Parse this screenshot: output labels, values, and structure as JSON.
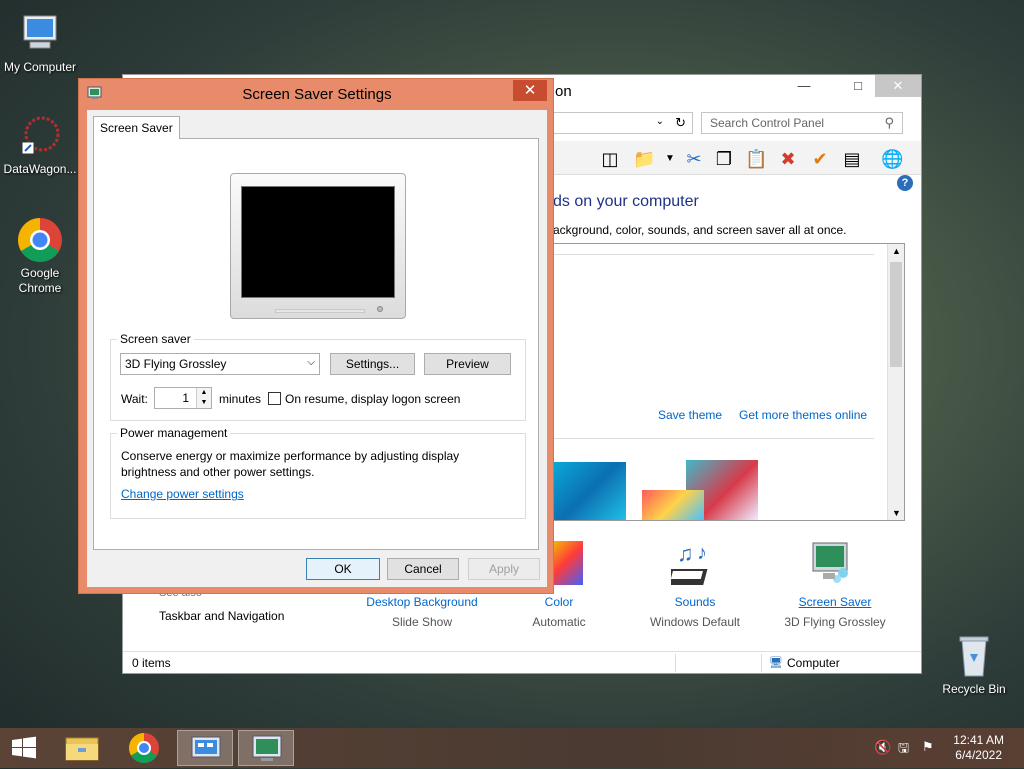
{
  "desktop": {
    "icons": [
      {
        "label": "My Computer",
        "icon": "computer-icon"
      },
      {
        "label": "DataWagon...",
        "icon": "shortcut-icon"
      },
      {
        "label": "Google Chrome",
        "icon": "chrome-icon"
      },
      {
        "label": "Recycle Bin",
        "icon": "recycle-bin-icon"
      }
    ]
  },
  "control_panel": {
    "title_fragment": "on",
    "search_placeholder": "Search Control Panel",
    "heading_fragment": "ds on your computer",
    "sub_fragment": "ackground, color, sounds, and screen saver all at once.",
    "save_theme": "Save theme",
    "get_more_themes": "Get more themes online",
    "see_also_fragment": "See also",
    "taskbar_nav": "Taskbar and Navigation",
    "bottom_items": [
      {
        "title": "Desktop Background",
        "value": "Slide Show"
      },
      {
        "title": "Color",
        "value": "Automatic"
      },
      {
        "title": "Sounds",
        "value": "Windows Default"
      },
      {
        "title": "Screen Saver",
        "value": "3D Flying Grossley"
      }
    ],
    "status_items": "0 items",
    "status_computer": "Computer"
  },
  "dialog": {
    "title": "Screen Saver Settings",
    "tab": "Screen Saver",
    "screen_saver_group": "Screen saver",
    "selected_saver": "3D Flying Grossley",
    "settings_button": "Settings...",
    "preview_button": "Preview",
    "wait_label": "Wait:",
    "wait_value": "1",
    "minutes_label": "minutes",
    "resume_label": "On resume, display logon screen",
    "power_group": "Power management",
    "power_text_1": "Conserve energy or maximize performance by adjusting display",
    "power_text_2": "brightness and other power settings.",
    "power_link": "Change power settings",
    "ok": "OK",
    "cancel": "Cancel",
    "apply": "Apply"
  },
  "taskbar": {
    "time": "12:41 AM",
    "date": "6/4/2022"
  }
}
